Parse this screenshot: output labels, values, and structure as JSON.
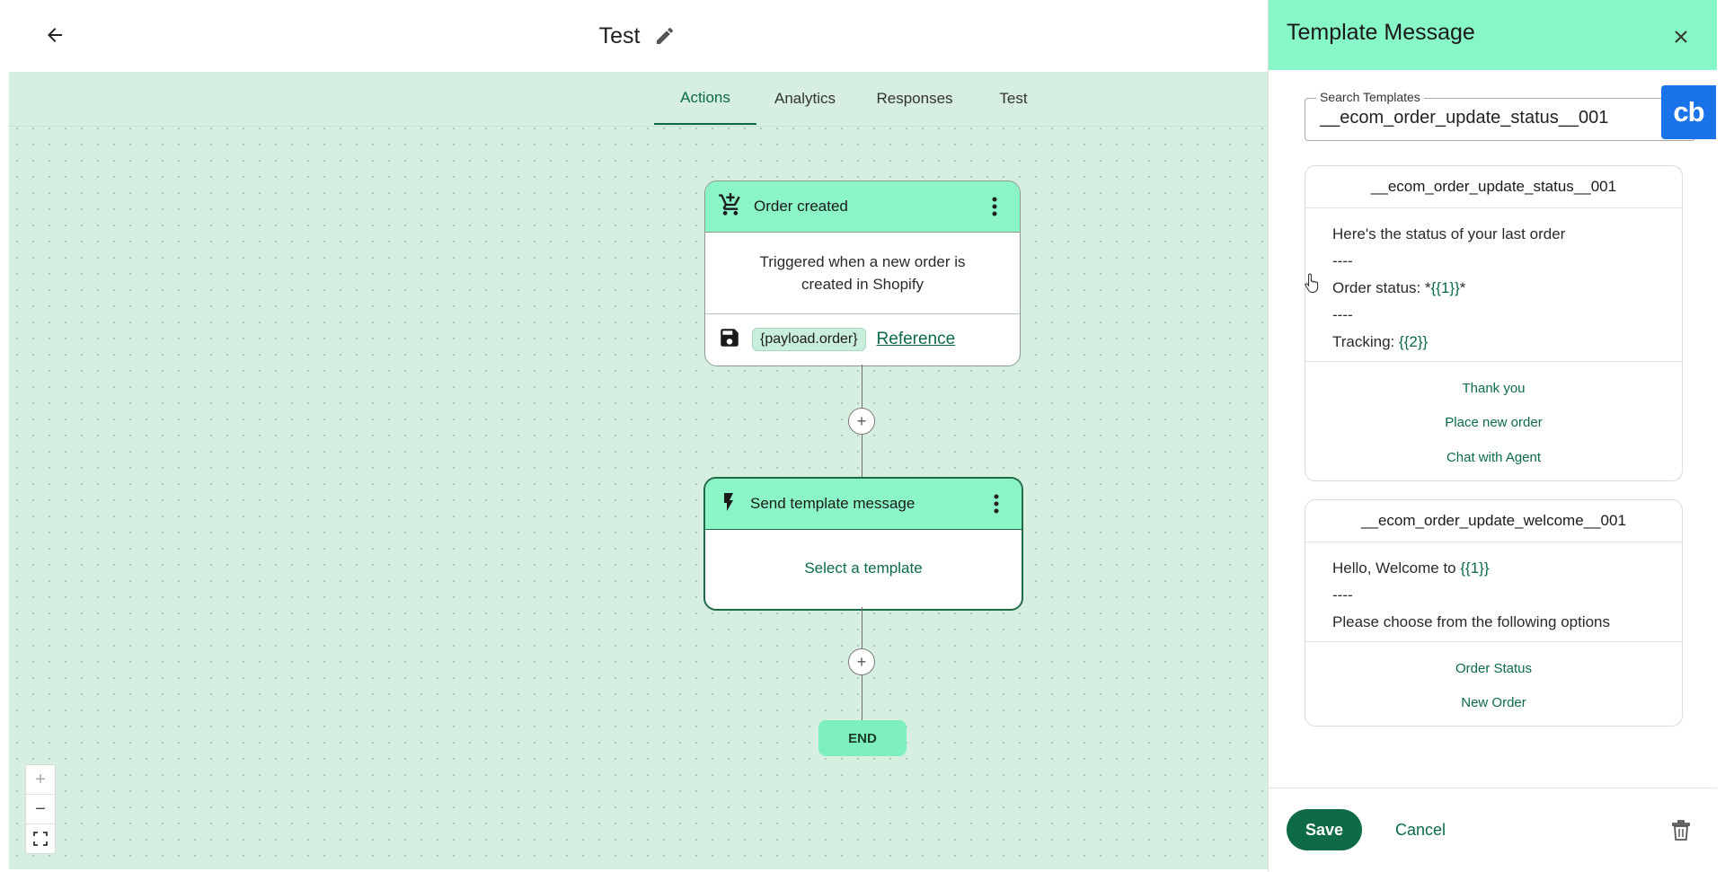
{
  "header": {
    "title": "Test"
  },
  "tabs": [
    {
      "label": "Actions",
      "active": true
    },
    {
      "label": "Analytics",
      "active": false
    },
    {
      "label": "Responses",
      "active": false
    },
    {
      "label": "Test",
      "active": false
    }
  ],
  "flow": {
    "trigger": {
      "icon": "cart-plus-icon",
      "title": "Order created",
      "description": "Triggered when a new order is created in Shopify",
      "variable": "{payload.order}",
      "reference_label": "Reference"
    },
    "action": {
      "icon": "lightning-icon",
      "title": "Send template message",
      "cta": "Select a template"
    },
    "end_label": "END"
  },
  "zoom_controls": {
    "zoom_in": "+",
    "zoom_out": "−",
    "fit": "fit-view-icon"
  },
  "panel": {
    "title": "Template Message",
    "search": {
      "label": "Search Templates",
      "value": "__ecom_order_update_status__001"
    },
    "badge": "cb",
    "templates": [
      {
        "name": "__ecom_order_update_status__001",
        "lines": [
          {
            "text": "Here's the status of your last order",
            "var": ""
          },
          {
            "text": "----",
            "var": ""
          },
          {
            "text": "Order status: *",
            "var": "{{1}}",
            "suffix": "*"
          },
          {
            "text": "----",
            "var": ""
          },
          {
            "text": "Tracking: ",
            "var": "{{2}}"
          }
        ],
        "buttons": [
          "Thank you",
          "Place new order",
          "Chat with Agent"
        ]
      },
      {
        "name": "__ecom_order_update_welcome__001",
        "lines": [
          {
            "text": "Hello, Welcome to ",
            "var": "{{1}}"
          },
          {
            "text": "----",
            "var": ""
          },
          {
            "text": "Please choose from the following options",
            "var": ""
          }
        ],
        "buttons": [
          "Order Status",
          "New Order"
        ]
      }
    ],
    "footer": {
      "save_label": "Save",
      "cancel_label": "Cancel"
    }
  },
  "colors": {
    "accent_dark": "#0f6b45",
    "header_mint": "#88f7c8",
    "canvas": "#d6efe0",
    "badge_blue": "#1a73e8"
  }
}
